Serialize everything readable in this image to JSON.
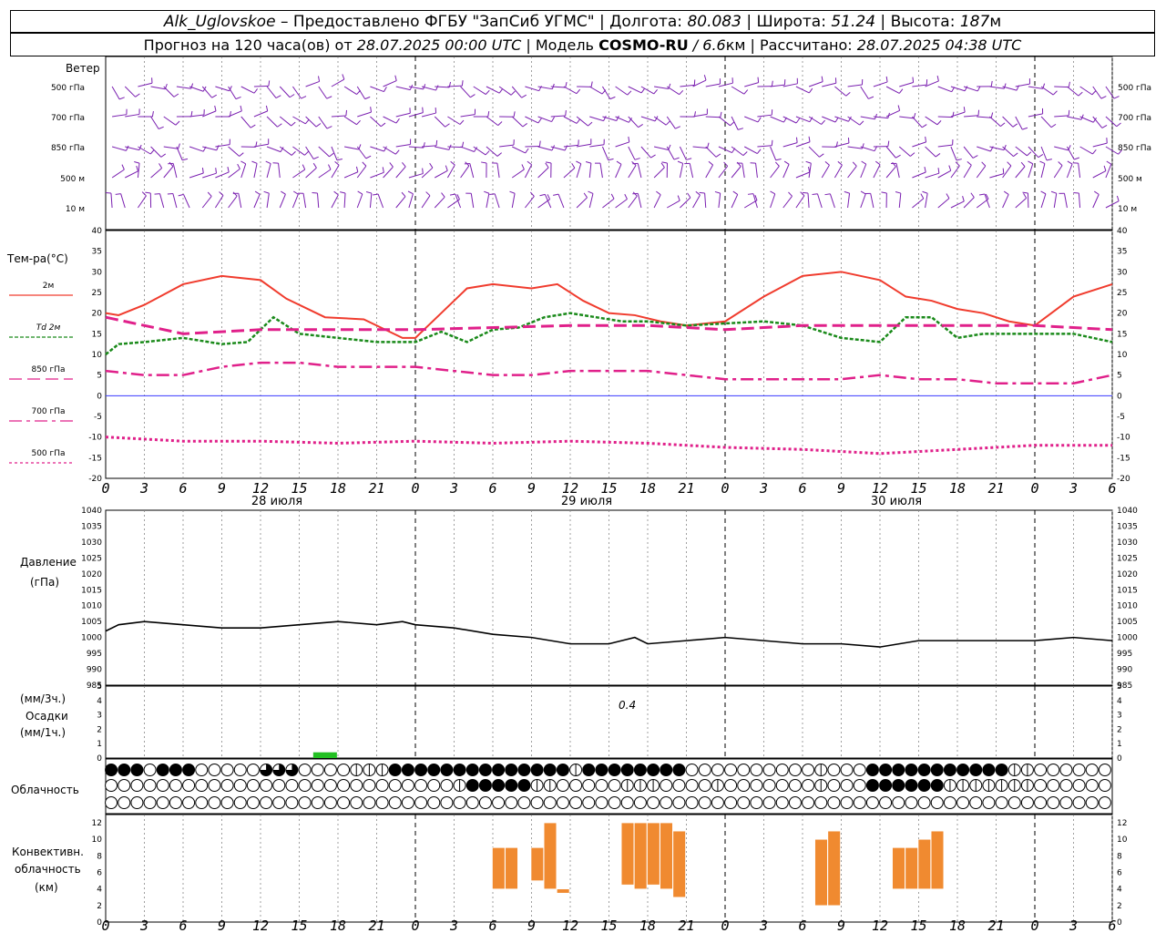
{
  "header": {
    "station": "Alk_Uglovskoe",
    "provider_sep": " – ",
    "provider": "Предоставлено ФГБУ \"ЗапСиб УГМС\"",
    "lon_label": "Долгота: ",
    "lon_value": "80.083",
    "lat_label": "Широта: ",
    "lat_value": "51.24",
    "alt_label": "Высота: ",
    "alt_value": "187",
    "alt_unit": "м",
    "forecast_label": "Прогноз на 120 часа(ов) от ",
    "forecast_time": "28.07.2025 00:00 UTC",
    "model_label": "Модель ",
    "model_name": "COSMO-RU",
    "model_res": " / 6.6",
    "model_res_unit": "км",
    "calc_label": "Рассчитано: ",
    "calc_time": "28.07.2025 04:38 UTC"
  },
  "labels": {
    "wind_title": "Ветер",
    "wind_levels": [
      "500 гПа",
      "700 гПа",
      "850 гПа",
      "500  м",
      "10   м"
    ],
    "temp_title": "Тем-ра(°С)",
    "temp_legend": [
      "2м",
      "Td  2м",
      "850 гПа",
      "700 гПа",
      "500 гПа"
    ],
    "pressure_title_1": "Давление",
    "pressure_title_2": "(гПа)",
    "precip_title_1": "(мм/3ч.)",
    "precip_title_2": "Осадки",
    "precip_title_3": "(мм/1ч.)",
    "precip_annotation": "0.4",
    "cloud_title": "Облачность",
    "conv_title_1": "Конвективн.",
    "conv_title_2": "облачность",
    "conv_title_3": "(км)",
    "dates": [
      "28 июля",
      "29 июля",
      "30 июля"
    ]
  },
  "colors": {
    "t2m": "#f03c2e",
    "td2m": "#1a8a1a",
    "t850": "#e0208a",
    "t700": "#e0208a",
    "t500": "#e0208a",
    "wind": "#7a1fb0",
    "pressure": "#000000",
    "precip": "#22c022",
    "conv": "#f08a30",
    "zero_line": "#3a3aff"
  },
  "chart_data": [
    {
      "type": "line",
      "title": "Тем-ра(°С)",
      "x_ticks": [
        "0",
        "3",
        "6",
        "9",
        "12",
        "15",
        "18",
        "21",
        "0",
        "3",
        "6",
        "9",
        "12",
        "15",
        "18",
        "21",
        "0",
        "3",
        "6",
        "9",
        "12",
        "15",
        "18",
        "21",
        "0",
        "3",
        "6"
      ],
      "x_hours": [
        0,
        78
      ],
      "ylim": [
        -20,
        40
      ],
      "y_ticks": [
        -20,
        -15,
        -10,
        -5,
        0,
        5,
        10,
        15,
        20,
        25,
        30,
        35,
        40
      ],
      "series": [
        {
          "name": "2м",
          "x": [
            0,
            1,
            3,
            6,
            9,
            12,
            14,
            17,
            20,
            23,
            24,
            26,
            28,
            30,
            33,
            35,
            37,
            39,
            41,
            43,
            45,
            48,
            51,
            54,
            57,
            60,
            62,
            64,
            66,
            68,
            70,
            72,
            75,
            78
          ],
          "values": [
            20,
            19.5,
            22,
            27,
            29,
            28,
            23.5,
            19,
            18.5,
            14,
            14,
            20,
            26,
            27,
            26,
            27,
            23,
            20,
            19.5,
            18,
            17,
            18,
            24,
            29,
            30,
            28,
            24,
            23,
            21,
            20,
            18,
            17,
            24,
            27
          ]
        },
        {
          "name": "Td  2м",
          "x": [
            0,
            1,
            3,
            6,
            9,
            11,
            13,
            15,
            18,
            21,
            24,
            26,
            28,
            30,
            32,
            34,
            36,
            38,
            40,
            42,
            45,
            48,
            51,
            54,
            57,
            60,
            62,
            64,
            66,
            68,
            72,
            75,
            78
          ],
          "values": [
            10,
            12.5,
            13,
            14,
            12.5,
            13,
            19,
            15,
            14,
            13,
            13,
            15.5,
            13,
            16,
            16.5,
            19,
            20,
            19,
            18,
            18,
            17,
            17.5,
            18,
            17,
            14,
            13,
            19,
            19,
            14,
            15,
            15,
            15,
            13
          ]
        },
        {
          "name": "850 гПа",
          "x": [
            0,
            6,
            12,
            18,
            24,
            30,
            36,
            42,
            48,
            54,
            60,
            66,
            72,
            78
          ],
          "values": [
            19,
            15,
            16,
            16,
            16,
            16.5,
            17,
            17,
            16,
            17,
            17,
            17,
            17,
            16
          ]
        },
        {
          "name": "700 гПа",
          "x": [
            0,
            3,
            6,
            9,
            12,
            15,
            18,
            21,
            24,
            27,
            30,
            33,
            36,
            39,
            42,
            45,
            48,
            51,
            54,
            57,
            60,
            63,
            66,
            69,
            72,
            75,
            78
          ],
          "values": [
            6,
            5,
            5,
            7,
            8,
            8,
            7,
            7,
            7,
            6,
            5,
            5,
            6,
            6,
            6,
            5,
            4,
            4,
            4,
            4,
            5,
            4,
            4,
            3,
            3,
            3,
            5
          ]
        },
        {
          "name": "500 гПа",
          "x": [
            0,
            6,
            12,
            18,
            24,
            30,
            36,
            42,
            48,
            54,
            60,
            66,
            72,
            78
          ],
          "values": [
            -10,
            -11,
            -11,
            -11.5,
            -11,
            -11.5,
            -11,
            -11.5,
            -12.5,
            -13,
            -14,
            -13,
            -12,
            -12
          ]
        }
      ]
    },
    {
      "type": "line",
      "title": "Давление",
      "ylabel": "(гПа)",
      "ylim": [
        985,
        1040
      ],
      "y_ticks": [
        985,
        990,
        995,
        1000,
        1005,
        1010,
        1015,
        1020,
        1025,
        1030,
        1035,
        1040
      ],
      "series": [
        {
          "x": [
            0,
            1,
            3,
            6,
            9,
            12,
            15,
            18,
            21,
            23,
            24,
            27,
            30,
            33,
            36,
            39,
            41,
            42,
            45,
            48,
            51,
            54,
            57,
            60,
            63,
            66,
            69,
            72,
            75,
            78
          ],
          "values": [
            1002,
            1004,
            1005,
            1004,
            1003,
            1003,
            1004,
            1005,
            1004,
            1005,
            1004,
            1003,
            1001,
            1000,
            998,
            998,
            1000,
            998,
            999,
            1000,
            999,
            998,
            998,
            997,
            999,
            999,
            999,
            999,
            1000,
            999
          ]
        }
      ]
    },
    {
      "type": "bar",
      "title": "Осадки",
      "ylim": [
        0,
        5
      ],
      "y_ticks": [
        0,
        1,
        2,
        3,
        4,
        5
      ],
      "x": [
        17
      ],
      "values": [
        0.4
      ]
    },
    {
      "type": "bar",
      "title": "Конвективн. облачность (км)",
      "ylim": [
        0,
        13
      ],
      "y_ticks": [
        0,
        2,
        4,
        6,
        8,
        10,
        12
      ],
      "columns": [
        {
          "hour": 30,
          "base": 4,
          "top": 9
        },
        {
          "hour": 31,
          "base": 4,
          "top": 9
        },
        {
          "hour": 33,
          "base": 5,
          "top": 9
        },
        {
          "hour": 34,
          "base": 4,
          "top": 12
        },
        {
          "hour": 35,
          "base": 3.5,
          "top": 4
        },
        {
          "hour": 40,
          "base": 4.5,
          "top": 12
        },
        {
          "hour": 41,
          "base": 4,
          "top": 12
        },
        {
          "hour": 42,
          "base": 4.5,
          "top": 12
        },
        {
          "hour": 43,
          "base": 4,
          "top": 12
        },
        {
          "hour": 44,
          "base": 3,
          "top": 11
        },
        {
          "hour": 55,
          "base": 2,
          "top": 10
        },
        {
          "hour": 56,
          "base": 2,
          "top": 11
        },
        {
          "hour": 61,
          "base": 4,
          "top": 9
        },
        {
          "hour": 62,
          "base": 4,
          "top": 9
        },
        {
          "hour": 63,
          "base": 4,
          "top": 10
        },
        {
          "hour": 64,
          "base": 4,
          "top": 11
        }
      ]
    }
  ],
  "clouds": {
    "rows": [
      [
        3,
        3,
        3,
        0,
        3,
        3,
        3,
        0,
        0,
        0,
        0,
        0,
        2,
        2,
        2,
        0,
        0,
        0,
        0,
        1,
        1,
        1,
        3,
        3,
        3,
        3,
        3,
        3,
        3,
        3,
        3,
        3,
        3,
        3,
        3,
        3,
        1,
        3,
        3,
        3,
        3,
        3,
        3,
        3,
        3,
        0,
        0,
        0,
        0,
        0,
        0,
        0,
        0,
        0,
        0,
        1,
        0,
        0,
        0,
        3,
        3,
        3,
        3,
        3,
        3,
        3,
        3,
        3,
        3,
        3,
        1,
        1,
        0,
        0,
        0,
        0,
        0,
        0
      ],
      [
        0,
        0,
        0,
        0,
        0,
        0,
        0,
        0,
        0,
        0,
        0,
        0,
        0,
        0,
        0,
        0,
        0,
        0,
        0,
        0,
        0,
        0,
        0,
        0,
        0,
        0,
        0,
        1,
        3,
        3,
        3,
        3,
        3,
        1,
        1,
        0,
        0,
        0,
        0,
        0,
        1,
        1,
        1,
        0,
        0,
        0,
        0,
        1,
        0,
        0,
        0,
        0,
        0,
        0,
        0,
        1,
        0,
        0,
        0,
        3,
        3,
        3,
        3,
        3,
        3,
        1,
        1,
        1,
        1,
        1,
        1,
        1,
        0,
        0,
        0,
        0,
        0,
        0
      ],
      [
        0,
        0,
        0,
        0,
        0,
        0,
        0,
        0,
        0,
        0,
        0,
        0,
        0,
        0,
        0,
        0,
        0,
        0,
        0,
        0,
        0,
        0,
        0,
        0,
        0,
        0,
        0,
        0,
        0,
        0,
        0,
        0,
        0,
        0,
        0,
        0,
        0,
        0,
        0,
        0,
        0,
        0,
        0,
        0,
        0,
        0,
        0,
        0,
        0,
        0,
        0,
        0,
        0,
        0,
        0,
        0,
        0,
        0,
        0,
        0,
        0,
        0,
        0,
        0,
        0,
        0,
        0,
        0,
        0,
        0,
        0,
        0,
        0,
        0,
        0,
        0,
        0,
        0
      ]
    ]
  }
}
